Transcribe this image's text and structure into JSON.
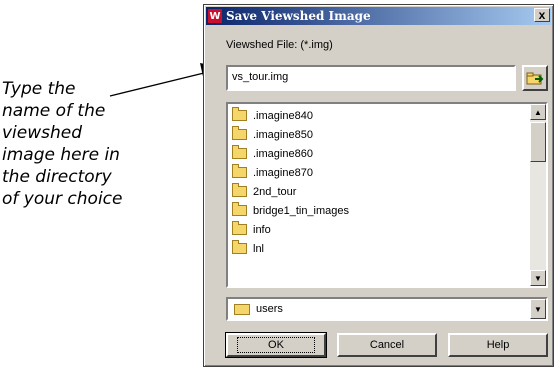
{
  "annotation": {
    "lines": [
      "Type the",
      "name of the",
      "viewshed",
      "image here in",
      "the directory",
      "of your choice"
    ]
  },
  "dialog": {
    "title": "Save Viewshed Image",
    "close_label": "x",
    "file_type_label": "Viewshed File: (*.img)",
    "filename_value": "vs_tour.img",
    "file_list": [
      ".imagine840",
      ".imagine850",
      ".imagine860",
      ".imagine870",
      "2nd_tour",
      "bridge1_tin_images",
      "info",
      "lnl"
    ],
    "directory": "users",
    "buttons": {
      "ok": "OK",
      "cancel": "Cancel",
      "help": "Help"
    }
  },
  "colors": {
    "title_bar": "#0a246a",
    "dialog_bg": "#d4d0c8",
    "folder": "#f4d66a"
  }
}
